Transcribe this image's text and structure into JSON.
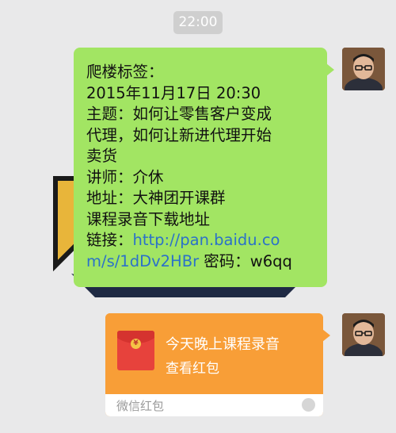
{
  "timestamp": "22:00",
  "text_message": {
    "lines": [
      "爬楼标签：",
      "2015年11月17日 20:30",
      "主题：如何让零售客户变成",
      "代理，如何让新进代理开始",
      "卖货",
      "讲师：介休",
      "地址：大神团开课群",
      "课程录音下载地址"
    ],
    "link_prefix": "链接：",
    "link_part1": "http://pan.baidu.co",
    "link_part2": "m/s/1dDv2HBr",
    "password": " 密码：w6qq"
  },
  "red_packet": {
    "title": "今天晚上课程录音",
    "subtitle": "查看红包",
    "footer": "微信红包",
    "coin_symbol": "¥"
  },
  "colors": {
    "background": "#e9e9ea",
    "text_bubble": "#a2e563",
    "red_packet": "#f89e37",
    "link": "#2b71c9"
  }
}
